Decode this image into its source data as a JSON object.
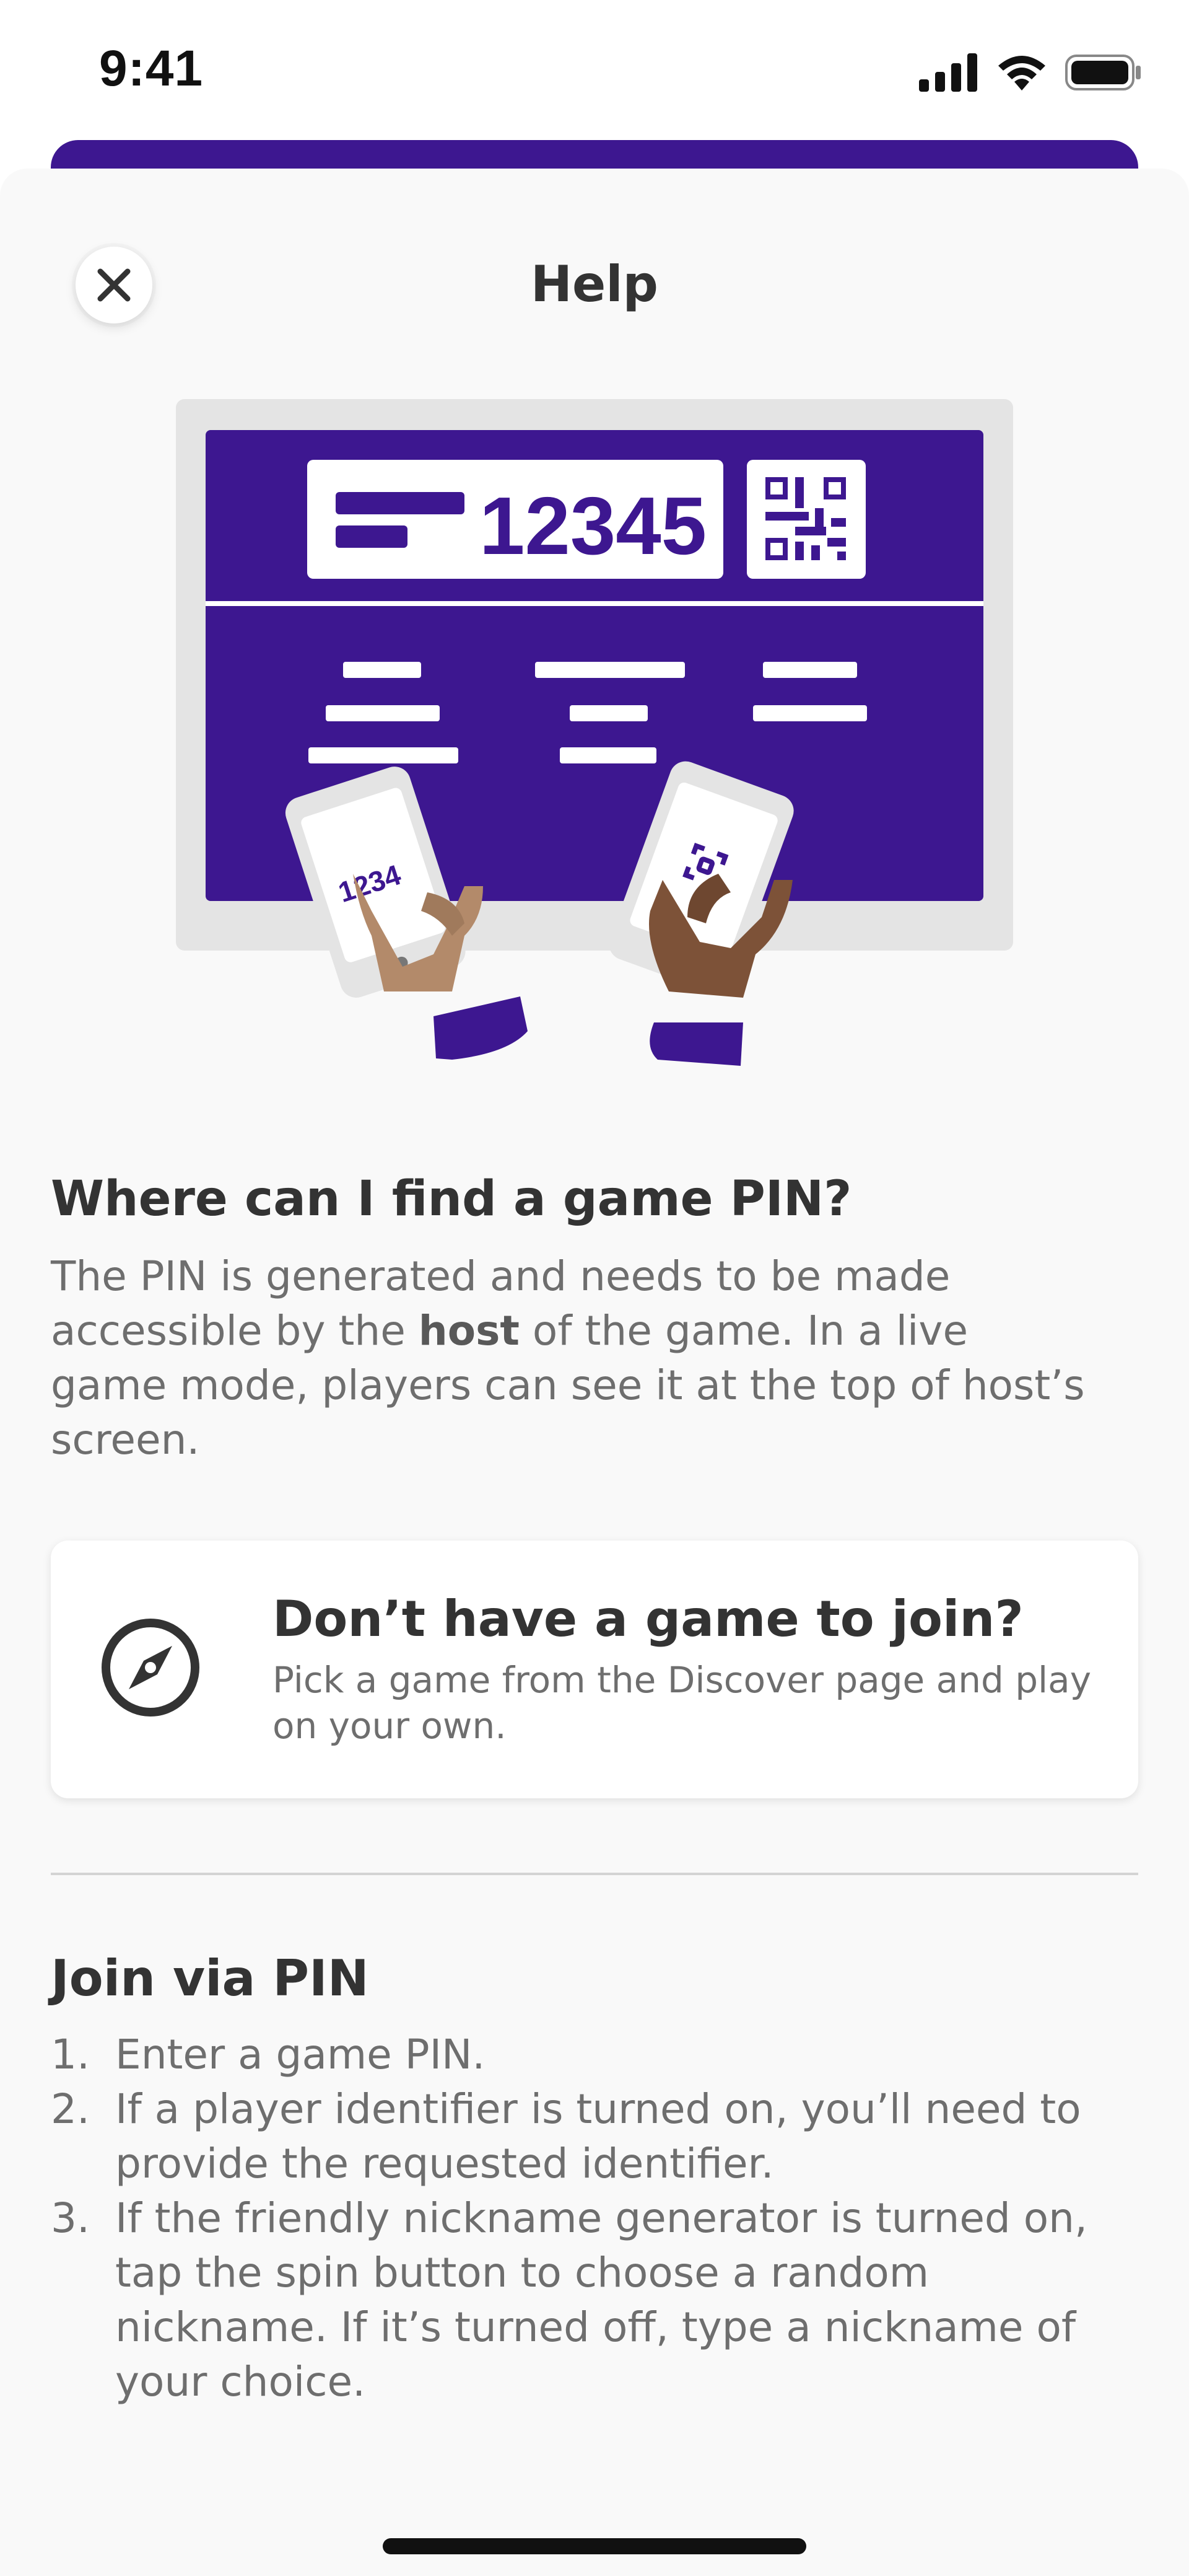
{
  "status_bar": {
    "time": "9:41"
  },
  "header": {
    "title": "Help",
    "close_icon": "close-icon"
  },
  "illustration": {
    "screen_pin": "12345",
    "phone_pin": "1234",
    "screen_color": "#3d1790",
    "frame_color": "#e4e4e4"
  },
  "find_pin": {
    "title": "Where can I find a game PIN?",
    "body_before": "The PIN is generated and needs to be made accessible by the ",
    "body_bold": "host",
    "body_after": " of the game. In a live game mode, players can see it at the top of host’s screen."
  },
  "discover_card": {
    "icon": "compass-icon",
    "title": "Don’t have a game to join?",
    "text": "Pick a game from the Discover page and play on your own."
  },
  "join": {
    "title": "Join via PIN",
    "steps": [
      {
        "num": "1.",
        "text": "Enter a game PIN."
      },
      {
        "num": "2.",
        "text": "If a player identifier is turned on, you’ll need to provide the requested identifier."
      },
      {
        "num": "3.",
        "text": "If the friendly nickname generator is turned on, tap the spin button to choose a random nickname. If it’s turned off, type a nickname of your choice."
      }
    ]
  },
  "colors": {
    "brand_purple": "#3d1790",
    "sheet_background": "#f9f9f9",
    "heading_text": "#333333",
    "body_text": "#6e6e6e"
  }
}
